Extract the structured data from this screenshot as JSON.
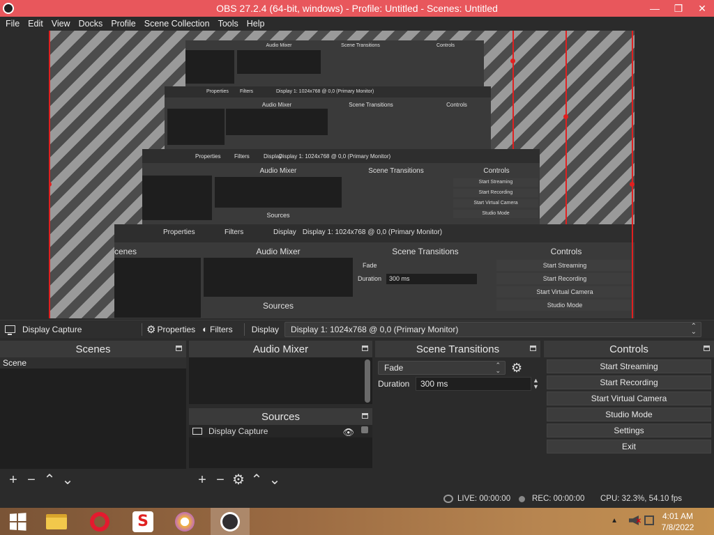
{
  "window": {
    "title": "OBS 27.2.4 (64-bit, windows) - Profile: Untitled - Scenes: Untitled",
    "minimize_glyph": "—",
    "maximize_glyph": "❐",
    "close_glyph": "✕"
  },
  "menu": [
    "File",
    "Edit",
    "View",
    "Docks",
    "Profile",
    "Scene Collection",
    "Tools",
    "Help"
  ],
  "preview_nested": {
    "display_text": "Display 1: 1024x768 @ 0,0 (Primary Monitor)",
    "properties": "Properties",
    "filters": "Filters",
    "display": "Display",
    "scenes_partial": "cenes",
    "audio_mixer": "Audio Mixer",
    "sources": "Sources",
    "scene_transitions": "Scene Transitions",
    "controls": "Controls",
    "fade": "Fade",
    "duration": "Duration",
    "duration_value": "300 ms",
    "start_streaming": "Start Streaming",
    "start_recording": "Start Recording",
    "start_virtual_camera": "Start Virtual Camera",
    "studio_mode": "Studio Mode"
  },
  "source_toolbar": {
    "source_name": "Display Capture",
    "properties_label": "Properties",
    "filters_label": "Filters",
    "display_label": "Display",
    "display_value": "Display 1: 1024x768 @ 0,0 (Primary Monitor)"
  },
  "scenes": {
    "title": "Scenes",
    "items": [
      "Scene"
    ]
  },
  "audio_mixer": {
    "title": "Audio Mixer"
  },
  "sources": {
    "title": "Sources",
    "items": [
      {
        "name": "Display Capture",
        "visible": true,
        "locked": false
      }
    ]
  },
  "transitions": {
    "title": "Scene Transitions",
    "selected": "Fade",
    "duration_label": "Duration",
    "duration_value": "300 ms"
  },
  "controls": {
    "title": "Controls",
    "buttons": [
      "Start Streaming",
      "Start Recording",
      "Start Virtual Camera",
      "Studio Mode",
      "Settings",
      "Exit"
    ]
  },
  "status": {
    "live": "LIVE: 00:00:00",
    "rec": "REC: 00:00:00",
    "cpu": "CPU: 32.3%, 54.10 fps"
  },
  "taskbar": {
    "time": "4:01 AM",
    "date": "7/8/2022",
    "apps": [
      "start",
      "file-explorer",
      "opera",
      "s-app",
      "lock-app",
      "obs"
    ]
  },
  "colors": {
    "title_bar": "#e8575c",
    "background": "#2b2b2b",
    "bounding_red": "#e02020"
  }
}
